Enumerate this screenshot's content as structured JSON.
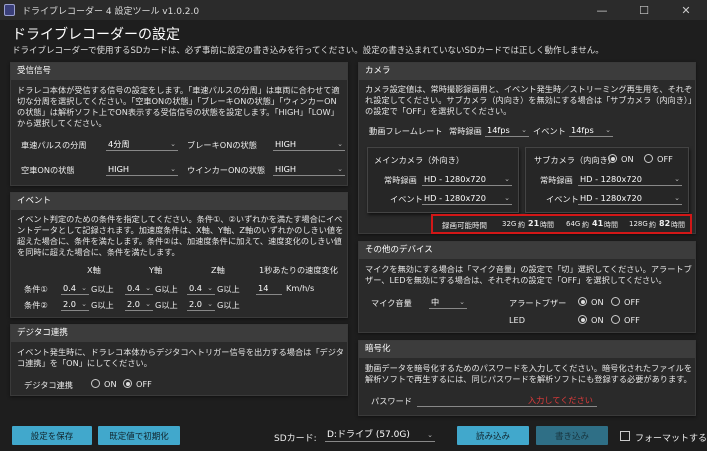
{
  "window": {
    "title": "ドライブレコーダー 4 設定ツール v1.0.2.0",
    "min": "—",
    "max": "☐",
    "close": "✕"
  },
  "header": {
    "title": "ドライブレコーダーの設定",
    "desc": "ドライブレコーダーで使用するSDカードは、必ず事前に設定の書き込みを行ってください。設定の書き込まれていないSDカードでは正しく動作しません。"
  },
  "receive": {
    "title": "受信信号",
    "desc": "ドラレコ本体が受信する信号の設定をします。「車速パルスの分周」は車両に合わせて適切な分周を選択してください。「空車ONの状態」「ブレーキONの状態」「ウィンカーONの状態」は解析ソフト上でON表示する受信信号の状態を設定します。「HIGH」「LOW」から選択してください。",
    "pulse_label": "車速パルスの分周",
    "pulse_value": "4分周",
    "brake_label": "ブレーキONの状態",
    "brake_value": "HIGH",
    "empty_label": "空車ONの状態",
    "empty_value": "HIGH",
    "winker_label": "ウインカーONの状態",
    "winker_value": "HIGH"
  },
  "event": {
    "title": "イベント",
    "desc": "イベント判定のための条件を指定してください。条件①、②いずれかを満たす場合にイベントデータとして記録されます。加速度条件は、X軸、Y軸、Z軸のいずれかのしきい値を超えた場合に、条件を満たします。条件②は、加速度条件に加えて、速度変化のしきい値を同時に超えた場合に、条件を満たします。",
    "col_x": "X軸",
    "col_y": "Y軸",
    "col_z": "Z軸",
    "col_speed": "1秒あたりの速度変化",
    "cond1_label": "条件①",
    "cond2_label": "条件②",
    "c1x": "0.4",
    "c1y": "0.4",
    "c1z": "0.4",
    "c2x": "2.0",
    "c2y": "2.0",
    "c2z": "2.0",
    "g_unit": "G以上",
    "speed_value": "14",
    "speed_unit": "Km/h/s"
  },
  "digitacho": {
    "title": "デジタコ連携",
    "desc": "イベント発生時に、ドラレコ本体からデジタコへトリガー信号を出力する場合は「デジタコ連携」を「ON」にしてください。",
    "label": "デジタコ連携",
    "on": "ON",
    "off": "OFF",
    "selected": "OFF"
  },
  "camera": {
    "title": "カメラ",
    "desc": "カメラ設定値は、常時撮影録画用と、イベント発生時／ストリーミング再生用を、それぞれ設定してください。サブカメラ（内向き）を無効にする場合は「サブカメラ（内向き）」の設定で「OFF」を選択してください。",
    "framerate_label": "動画フレームレート",
    "always_label": "常時録画",
    "always_fps": "14fps",
    "event_label": "イベント",
    "event_fps": "14fps",
    "main_title": "メインカメラ（外向き）",
    "main_always_label": "常時録画",
    "main_always": "HD - 1280x720",
    "main_event_label": "イベント",
    "main_event": "HD - 1280x720",
    "sub_title": "サブカメラ（内向き）",
    "sub_on": "ON",
    "sub_off": "OFF",
    "sub_always_label": "常時録画",
    "sub_always": "HD - 1280x720",
    "sub_event_label": "イベント",
    "sub_event": "HD - 1280x720",
    "rec_label": "録画可能時間",
    "rec_items": [
      {
        "size": "32G",
        "time": "約",
        "hours": "21",
        "unit": "時間"
      },
      {
        "size": "64G",
        "time": "約",
        "hours": "41",
        "unit": "時間"
      },
      {
        "size": "128G",
        "time": "約",
        "hours": "82",
        "unit": "時間"
      }
    ]
  },
  "other": {
    "title": "その他のデバイス",
    "desc": "マイクを無効にする場合は「マイク音量」の設定で「切」選択してください。アラートブザー、LEDを無効にする場合は、それぞれの設定で「OFF」を選択してください。",
    "mic_label": "マイク音量",
    "mic_value": "中",
    "buzzer_label": "アラートブザー",
    "led_label": "LED",
    "on": "ON",
    "off": "OFF"
  },
  "encrypt": {
    "title": "暗号化",
    "desc": "動画データを暗号化するためのパスワードを入力してください。暗号化されたファイルを解析ソフトで再生するには、同じパスワードを解析ソフトにも登録する必要があります。",
    "pw_label": "パスワード",
    "pw_hint": "入力してください"
  },
  "footer": {
    "save": "設定を保存",
    "init": "既定値で初期化",
    "sd_label": "SDカード:",
    "sd_value": "D:ドライブ (57.0G)",
    "read": "読み込み",
    "write": "書き込み",
    "format": "フォーマットする"
  },
  "colors": {
    "accent": "#41a8cc",
    "highlight": "#d21717",
    "warning": "#e23b3b"
  }
}
